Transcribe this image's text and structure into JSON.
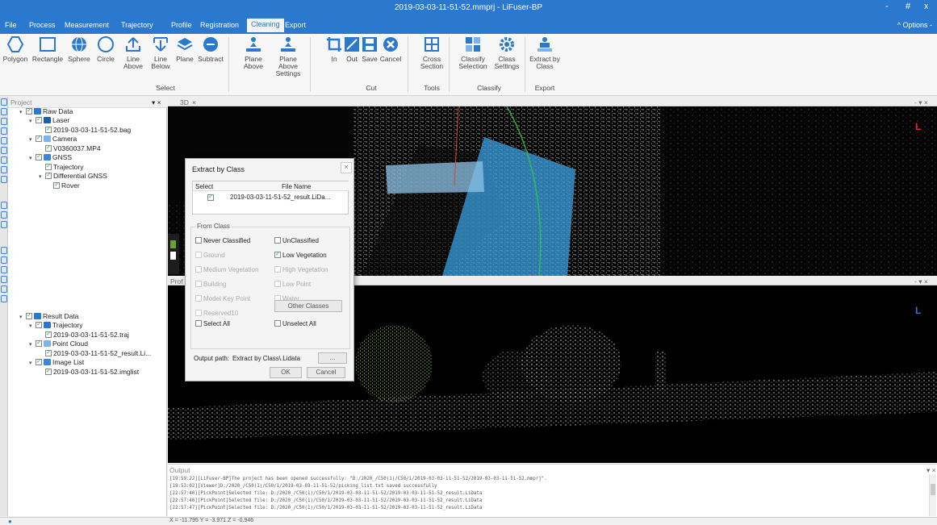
{
  "window": {
    "title": "2019-03-03-11-51-52.mmprj - LiFuser-BP",
    "minimize": "-",
    "maximize": "#",
    "close": "x"
  },
  "menu": {
    "items": [
      "File",
      "Process",
      "Measurement",
      "Trajectory",
      "Profile",
      "Registration",
      "Cleaning",
      "Export"
    ],
    "active": "Cleaning",
    "options": "^ Options -"
  },
  "ribbon": {
    "select_buttons": [
      {
        "label1": "Polygon",
        "label2": ""
      },
      {
        "label1": "Rectangle",
        "label2": ""
      },
      {
        "label1": "Sphere",
        "label2": ""
      },
      {
        "label1": "Circle",
        "label2": ""
      },
      {
        "label1": "Line",
        "label2": "Above"
      },
      {
        "label1": "Line",
        "label2": "Below"
      },
      {
        "label1": "Plane",
        "label2": ""
      },
      {
        "label1": "Subtract",
        "label2": ""
      }
    ],
    "plane_buttons": [
      {
        "label1": "Plane",
        "label2": "Above"
      },
      {
        "label1": "Plane Above",
        "label2": "Settings"
      }
    ],
    "cut_buttons": [
      {
        "label1": "In",
        "label2": ""
      },
      {
        "label1": "Out",
        "label2": ""
      },
      {
        "label1": "Save",
        "label2": ""
      },
      {
        "label1": "Cancel",
        "label2": ""
      }
    ],
    "tools_button": {
      "label1": "Cross",
      "label2": "Section"
    },
    "classify_buttons": [
      {
        "label1": "Classify",
        "label2": "Selection"
      },
      {
        "label1": "Class",
        "label2": "Settings"
      }
    ],
    "export_button": {
      "label1": "Extract by",
      "label2": "Class"
    },
    "groups": {
      "select": "Select",
      "cut": "Cut",
      "tools": "Tools",
      "classify": "Classify",
      "export": "Export"
    }
  },
  "project": {
    "header": "Project",
    "pin": "▾ ×",
    "raw": [
      "Raw Data",
      "Laser",
      "2019-03-03-11-51-52.bag",
      "Camera",
      "V0360037.MP4",
      "GNSS",
      "Trajectory",
      "Differential GNSS",
      "Rover"
    ],
    "result": [
      "Result Data",
      "Trajectory",
      "2019-03-03-11-51-52.traj",
      "Point Cloud",
      "2019-03-03-11-51-52_result.Li...",
      "Image List",
      "2019-03-03-11-51-52.imglist"
    ]
  },
  "views": {
    "tab3d": "3D",
    "tab3d_close": "×",
    "tabprofile": "Prof",
    "controls": "- ▾ ×",
    "axis": "L"
  },
  "dialog": {
    "title": "Extract by Class",
    "close": "×",
    "table_headers": [
      "Select",
      "File Name"
    ],
    "file_row": "2019-03-03-11-51-52_result.LiDa...",
    "from_class_label": "From Class",
    "classes": [
      {
        "name": "Never Classified",
        "checked": false,
        "enabled": true
      },
      {
        "name": "UnClassified",
        "checked": false,
        "enabled": true
      },
      {
        "name": "Ground",
        "checked": false,
        "enabled": false
      },
      {
        "name": "Low Vegetation",
        "checked": true,
        "enabled": true
      },
      {
        "name": "Medium Vegetation",
        "checked": false,
        "enabled": false
      },
      {
        "name": "High Vegetation",
        "checked": false,
        "enabled": false
      },
      {
        "name": "Building",
        "checked": false,
        "enabled": false
      },
      {
        "name": "Low Point",
        "checked": false,
        "enabled": false
      },
      {
        "name": "Model Key Point",
        "checked": false,
        "enabled": false
      },
      {
        "name": "Water",
        "checked": false,
        "enabled": false
      },
      {
        "name": "Reserved10",
        "checked": false,
        "enabled": false
      }
    ],
    "other_classes": "Other Classes",
    "select_all": "Select All",
    "unselect_all": "Unselect All",
    "output_label": "Output path:",
    "output_value": "Extract by Class\\.Lidata",
    "browse": "...",
    "ok": "OK",
    "cancel": "Cancel"
  },
  "output": {
    "header": "Output",
    "lines": [
      "[19:59:22][LiFuser-BP]The project has been opened successfully: \"D:/2020_/C50(1)/C50/1/2019-03-03-11-51-52/2019-03-03-11-51-52.mmprj\".",
      "[19:53:02][Viewer]D:/2020_/C50(1)/C50/1/2019-03-03-11-51-52/picking_list.txt saved successfully",
      "[22:57:40][PickPoint]Selected file: D:/2020_/C50(1)/C50/1/2019-03-03-11-51-52/2019-03-03-11-51-52_result.LiData",
      "[22:57:46][PickPoint]Selected file: D:/2020_/C50(1)/C50/1/2019-03-03-11-51-52/2019-03-03-11-51-52_result.LiData",
      "[22:57:47][PickPoint]Selected file: D:/2020_/C50(1)/C50/1/2019-03-03-11-51-52/2019-03-03-11-51-52_result.LiData"
    ]
  },
  "status": {
    "coords": "X = -11.795 Y = -3.971 Z = -0.946"
  },
  "colors": {
    "accent": "#2b78cf",
    "plane": "#3aa0e0",
    "trajectory": "#2ecc40"
  }
}
